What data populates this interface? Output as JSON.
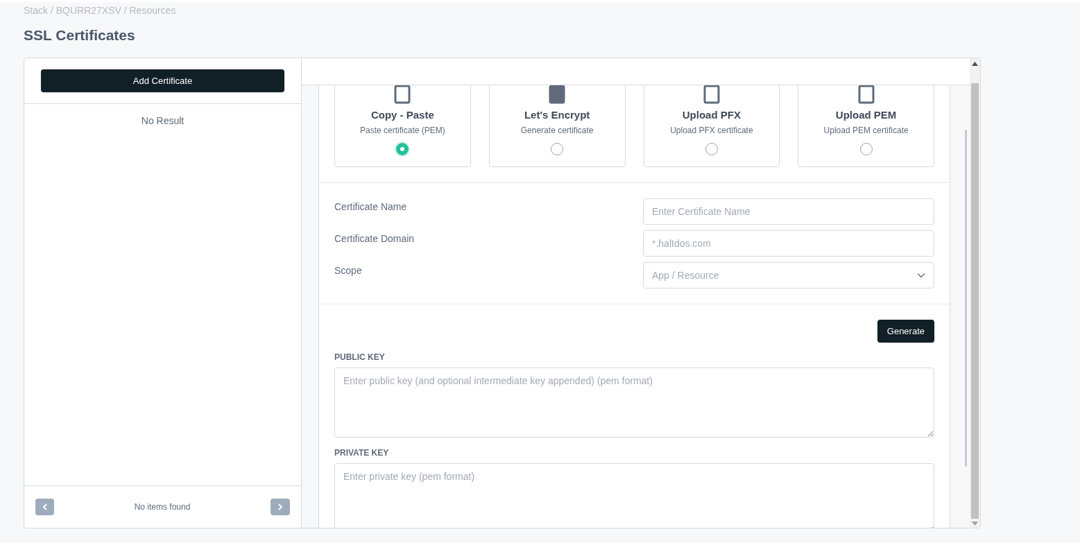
{
  "breadcrumb": "Stack / BQURR27XSV / Resources",
  "title": "SSL Certificates",
  "sidebar": {
    "add_button": "Add Certificate",
    "empty_text": "No Result",
    "pagination_text": "No items found"
  },
  "options": [
    {
      "title": "Copy - Paste",
      "subtitle": "Paste certificate (PEM)",
      "selected": true
    },
    {
      "title": "Let's Encrypt",
      "subtitle": "Generate certificate",
      "selected": false
    },
    {
      "title": "Upload PFX",
      "subtitle": "Upload PFX certificate",
      "selected": false
    },
    {
      "title": "Upload PEM",
      "subtitle": "Upload PEM certificate",
      "selected": false
    }
  ],
  "fields": [
    {
      "label": "Certificate Name",
      "placeholder": "Enter Certificate Name",
      "kind": "text"
    },
    {
      "label": "Certificate Domain",
      "placeholder": "*.haltdos.com",
      "kind": "text"
    },
    {
      "label": "Scope",
      "placeholder": "App / Resource",
      "kind": "select"
    }
  ],
  "generate_button": "Generate",
  "keys": [
    {
      "label": "PUBLIC KEY",
      "placeholder": "Enter public key (and optional intermediate key appended) (pem format)"
    },
    {
      "label": "PRIVATE KEY",
      "placeholder": "Enter private key (pem format)"
    }
  ]
}
